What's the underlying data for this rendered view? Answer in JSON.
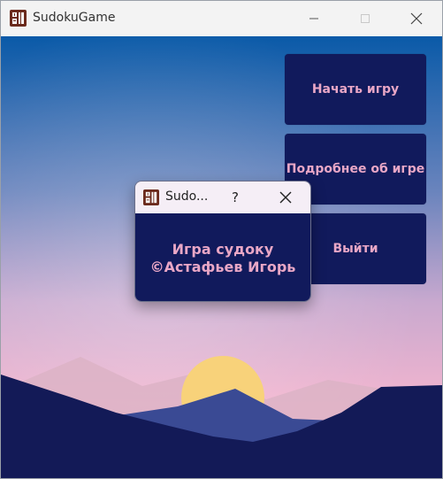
{
  "window": {
    "title": "SudokuGame",
    "icon": "app-grid-icon"
  },
  "menu": {
    "start_label": "Начать игру",
    "about_label": "Подробнее об игре",
    "exit_label": "Выйти"
  },
  "dialog": {
    "title": "Sudo...",
    "help_label": "?",
    "line1": "Игра судоку",
    "line2": "©Астафьев Игорь"
  },
  "colors": {
    "button_bg": "#111a5c",
    "button_text": "#e9a7c6",
    "sky_top": "#0a5aa8",
    "sky_bottom": "#f6b6cf",
    "sun": "#f8d27a",
    "hills": "#131a57"
  }
}
